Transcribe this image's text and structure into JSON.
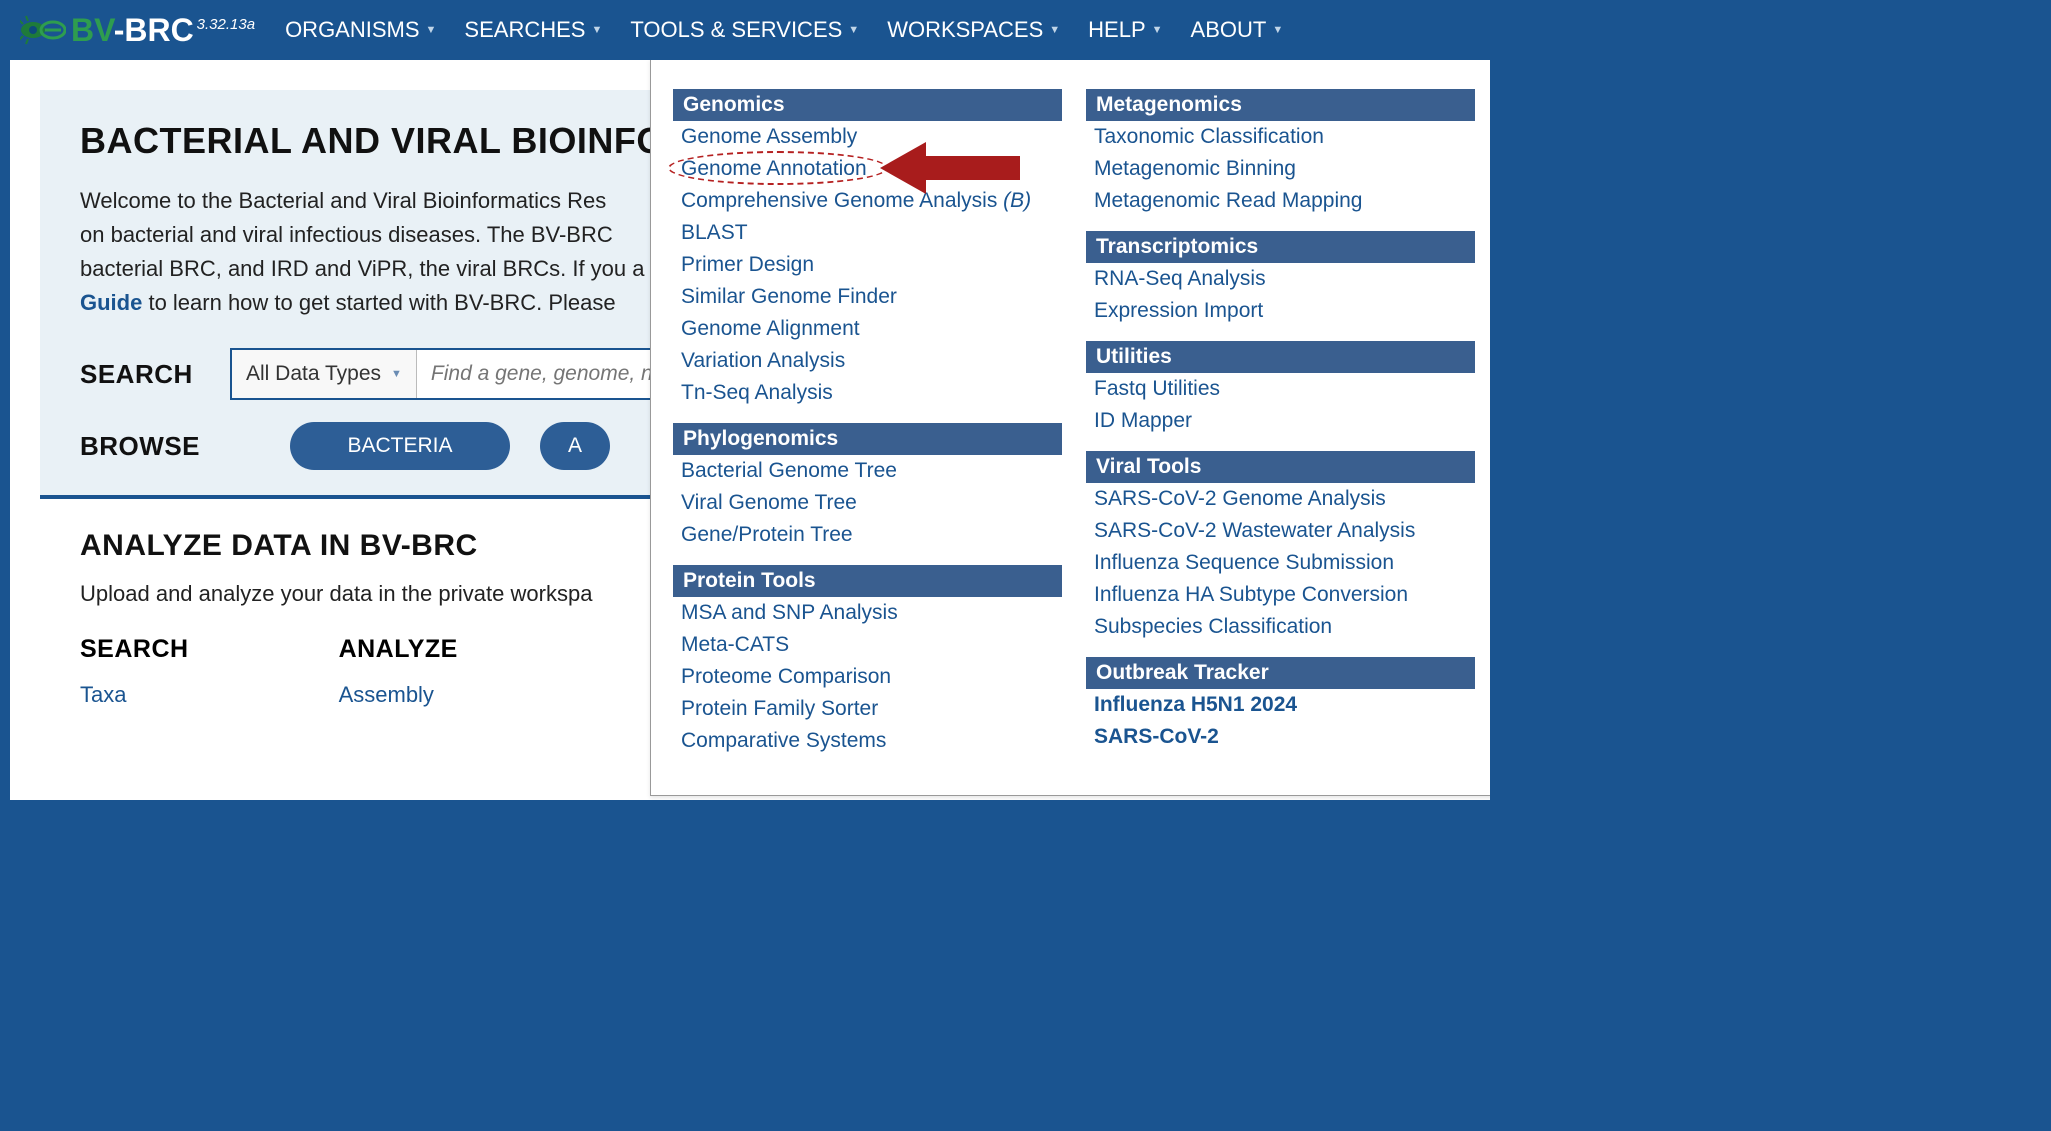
{
  "brand": {
    "bv": "BV",
    "brc": "-BRC",
    "version": "3.32.13a"
  },
  "nav": {
    "organisms": "ORGANISMS",
    "searches": "SEARCHES",
    "tools": "TOOLS & SERVICES",
    "workspaces": "WORKSPACES",
    "help": "HELP",
    "about": "ABOUT"
  },
  "hero": {
    "title": "BACTERIAL AND VIRAL BIOINFOR",
    "p1": "Welcome to the Bacterial and Viral Bioinformatics Res",
    "p2": "on bacterial and viral infectious diseases. The BV-BRC ",
    "p3": "bacterial BRC, and IRD and ViPR, the viral BRCs. If you a",
    "guide": "Guide",
    "p4": " to learn how to get started with BV-BRC. Please ",
    "search_label": "SEARCH",
    "search_select": "All Data Types",
    "search_placeholder": "Find a gene, genome, n",
    "browse_label": "BROWSE",
    "browse_btn1": "BACTERIA",
    "browse_btn2": "A"
  },
  "section2": {
    "title": "ANALYZE DATA IN BV-BRC",
    "lead": "Upload and analyze your data in the private workspa",
    "col1_head": "SEARCH",
    "col1_link1": "Taxa",
    "col2_head": "ANALYZE",
    "col2_link1": "Assembly"
  },
  "mega": {
    "col1": {
      "g1": {
        "header": "Genomics",
        "i1": "Genome Assembly",
        "i2": "Genome Annotation",
        "i3": "Comprehensive Genome Analysis ",
        "i3b": "(B)",
        "i4": "BLAST",
        "i5": "Primer Design",
        "i6": "Similar Genome Finder",
        "i7": "Genome Alignment",
        "i8": "Variation Analysis",
        "i9": "Tn-Seq Analysis"
      },
      "g2": {
        "header": "Phylogenomics",
        "i1": "Bacterial Genome Tree",
        "i2": "Viral Genome Tree",
        "i3": "Gene/Protein Tree"
      },
      "g3": {
        "header": "Protein Tools",
        "i1": "MSA and SNP Analysis",
        "i2": "Meta-CATS",
        "i3": "Proteome Comparison",
        "i4": "Protein Family Sorter",
        "i5": "Comparative Systems"
      }
    },
    "col2": {
      "g1": {
        "header": "Metagenomics",
        "i1": "Taxonomic Classification",
        "i2": "Metagenomic Binning",
        "i3": "Metagenomic Read Mapping"
      },
      "g2": {
        "header": "Transcriptomics",
        "i1": "RNA-Seq Analysis",
        "i2": "Expression Import"
      },
      "g3": {
        "header": "Utilities",
        "i1": "Fastq Utilities",
        "i2": "ID Mapper"
      },
      "g4": {
        "header": "Viral Tools",
        "i1": "SARS-CoV-2 Genome Analysis",
        "i2": "SARS-CoV-2 Wastewater Analysis",
        "i3": "Influenza Sequence Submission",
        "i4": "Influenza HA Subtype Conversion",
        "i5": "Subspecies Classification"
      },
      "g5": {
        "header": "Outbreak Tracker",
        "i1": "Influenza H5N1 2024",
        "i2": "SARS-CoV-2"
      }
    }
  }
}
